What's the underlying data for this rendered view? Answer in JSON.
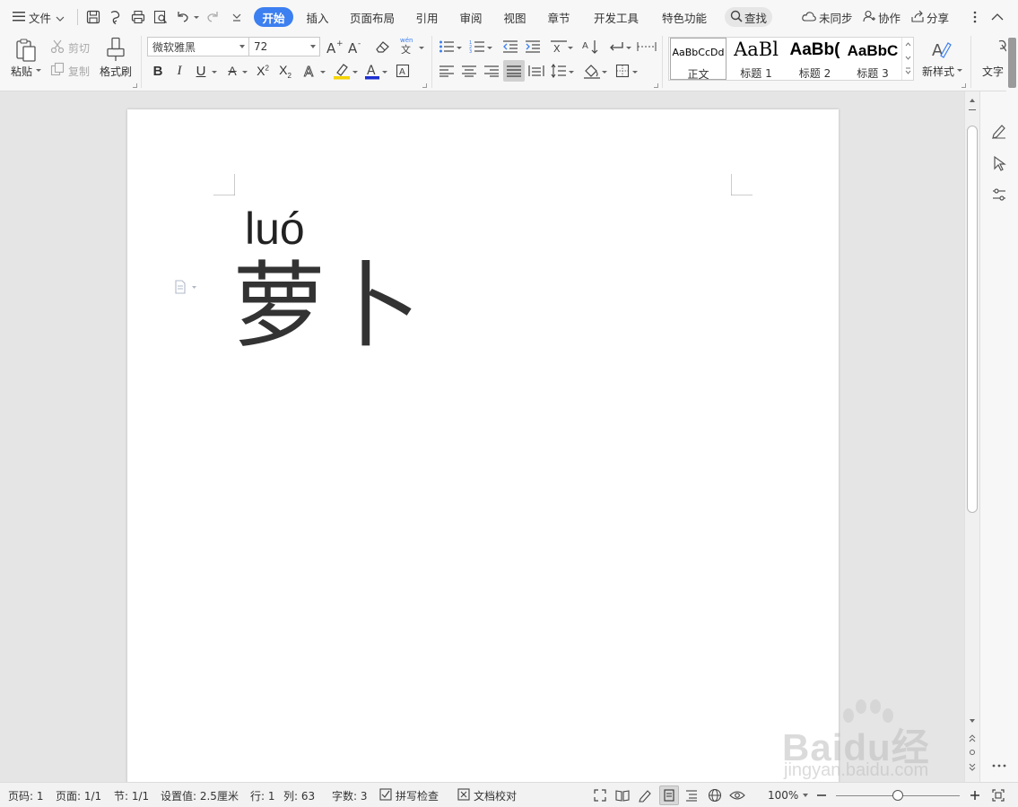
{
  "menubar": {
    "hamburger_label": "文件",
    "tabs": [
      {
        "label": "开始",
        "active": true
      },
      {
        "label": "插入"
      },
      {
        "label": "页面布局"
      },
      {
        "label": "引用"
      },
      {
        "label": "审阅"
      },
      {
        "label": "视图"
      },
      {
        "label": "章节"
      },
      {
        "label": "开发工具"
      },
      {
        "label": "特色功能"
      }
    ],
    "find_label": "查找",
    "sync_label": "未同步",
    "collab_label": "协作",
    "share_label": "分享",
    "accent_color": "#3c7ff0"
  },
  "ribbon": {
    "paste_label": "粘贴",
    "cut_label": "剪切",
    "copy_label": "复制",
    "format_painter_label": "格式刷",
    "font_name": "微软雅黑",
    "font_size": "72",
    "phonetic_glyph": "wén",
    "styles": [
      {
        "sample": "AaBbCcDd",
        "name": "正文"
      },
      {
        "sample": "AaBl",
        "name": "标题 1"
      },
      {
        "sample": "AaBb(",
        "name": "标题 2"
      },
      {
        "sample": "AaBbC",
        "name": "标题 3"
      }
    ],
    "new_style_label": "新样式",
    "text_tool_label": "文字"
  },
  "document": {
    "pinyin": "luó",
    "characters": "萝卜"
  },
  "watermark": {
    "brand": "Baidu经验",
    "url": "jingyan.baidu.com"
  },
  "statusbar": {
    "page_code": "页码: 1",
    "pages": "页面: 1/1",
    "section": "节: 1/1",
    "setting": "设置值: 2.5厘米",
    "row": "行: 1",
    "col": "列: 63",
    "word_count": "字数: 3",
    "spell_check": "拼写检查",
    "doc_proof": "文档校对",
    "zoom": "100%",
    "zoom_fraction": 0.5
  }
}
